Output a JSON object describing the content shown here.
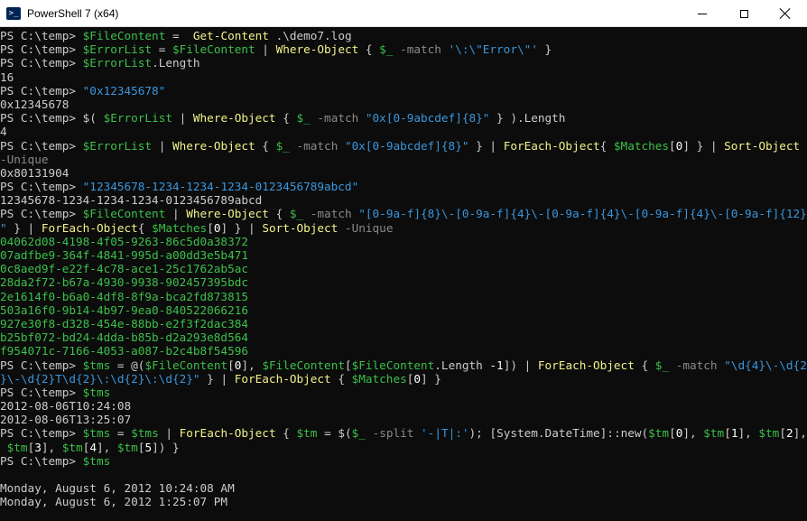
{
  "window": {
    "title": "PowerShell 7 (x64)",
    "icon": "powershell-icon",
    "icon_glyph": ">_",
    "controls": [
      "minimize-icon",
      "maximize-icon",
      "close-icon"
    ]
  },
  "colors": {
    "background": "#0c0c0c",
    "prompt": "#cccccc",
    "variable": "#3cc04a",
    "command": "#f2f28c",
    "string": "#3a96dd",
    "parameter": "#8a8a8a",
    "output": "#cccccc",
    "guid_output": "#3cc04a"
  },
  "console": {
    "lines": [
      [
        [
          "prompt",
          "PS C:\\temp> "
        ],
        [
          "var",
          "$FileContent"
        ],
        [
          "txt",
          " =  "
        ],
        [
          "cmd",
          "Get-Content"
        ],
        [
          "txt",
          " .\\demo7.log"
        ]
      ],
      [
        [
          "prompt",
          "PS C:\\temp> "
        ],
        [
          "var",
          "$ErrorList"
        ],
        [
          "txt",
          " = "
        ],
        [
          "var",
          "$FileContent"
        ],
        [
          "txt",
          " | "
        ],
        [
          "cmd",
          "Where-Object"
        ],
        [
          "txt",
          " { "
        ],
        [
          "var",
          "$_"
        ],
        [
          "txt",
          " "
        ],
        [
          "param",
          "-match"
        ],
        [
          "txt",
          " "
        ],
        [
          "str",
          "'\\:\\\"Error\\\"'"
        ],
        [
          "txt",
          " }"
        ]
      ],
      [
        [
          "prompt",
          "PS C:\\temp> "
        ],
        [
          "var",
          "$ErrorList"
        ],
        [
          "txt",
          "."
        ],
        [
          "txt",
          "Length"
        ]
      ],
      [
        [
          "out",
          "16"
        ]
      ],
      [
        [
          "prompt",
          "PS C:\\temp> "
        ],
        [
          "str",
          "\"0x12345678\""
        ]
      ],
      [
        [
          "out",
          "0x12345678"
        ]
      ],
      [
        [
          "prompt",
          "PS C:\\temp> "
        ],
        [
          "txt",
          "$( "
        ],
        [
          "var",
          "$ErrorList"
        ],
        [
          "txt",
          " | "
        ],
        [
          "cmd",
          "Where-Object"
        ],
        [
          "txt",
          " { "
        ],
        [
          "var",
          "$_"
        ],
        [
          "txt",
          " "
        ],
        [
          "param",
          "-match"
        ],
        [
          "txt",
          " "
        ],
        [
          "str",
          "\"0x[0-9abcdef]{8}\""
        ],
        [
          "txt",
          " } ).Length"
        ]
      ],
      [
        [
          "out",
          "4"
        ]
      ],
      [
        [
          "prompt",
          "PS C:\\temp> "
        ],
        [
          "var",
          "$ErrorList"
        ],
        [
          "txt",
          " | "
        ],
        [
          "cmd",
          "Where-Object"
        ],
        [
          "txt",
          " { "
        ],
        [
          "var",
          "$_"
        ],
        [
          "txt",
          " "
        ],
        [
          "param",
          "-match"
        ],
        [
          "txt",
          " "
        ],
        [
          "str",
          "\"0x[0-9abcdef]{8}\""
        ],
        [
          "txt",
          " } | "
        ],
        [
          "cmd",
          "ForEach-Object"
        ],
        [
          "txt",
          "{ "
        ],
        [
          "var",
          "$Matches"
        ],
        [
          "txt",
          "["
        ],
        [
          "num",
          "0"
        ],
        [
          "txt",
          "] } | "
        ],
        [
          "cmd",
          "Sort-Object"
        ]
      ],
      [
        [
          "param",
          "-Unique"
        ]
      ],
      [
        [
          "out",
          "0x80131904"
        ]
      ],
      [
        [
          "prompt",
          "PS C:\\temp> "
        ],
        [
          "str",
          "\"12345678-1234-1234-1234-0123456789abcd\""
        ]
      ],
      [
        [
          "out",
          "12345678-1234-1234-1234-0123456789abcd"
        ]
      ],
      [
        [
          "prompt",
          "PS C:\\temp> "
        ],
        [
          "var",
          "$FileContent"
        ],
        [
          "txt",
          " | "
        ],
        [
          "cmd",
          "Where-Object"
        ],
        [
          "txt",
          " { "
        ],
        [
          "var",
          "$_"
        ],
        [
          "txt",
          " "
        ],
        [
          "param",
          "-match"
        ],
        [
          "txt",
          " "
        ],
        [
          "str",
          "\"[0-9a-f]{8}\\-[0-9a-f]{4}\\-[0-9a-f]{4}\\-[0-9a-f]{4}\\-[0-9a-f]{12}"
        ]
      ],
      [
        [
          "str",
          "\""
        ],
        [
          "txt",
          " } | "
        ],
        [
          "cmd",
          "ForEach-Object"
        ],
        [
          "txt",
          "{ "
        ],
        [
          "var",
          "$Matches"
        ],
        [
          "txt",
          "["
        ],
        [
          "num",
          "0"
        ],
        [
          "txt",
          "] } | "
        ],
        [
          "cmd",
          "Sort-Object"
        ],
        [
          "txt",
          " "
        ],
        [
          "param",
          "-Unique"
        ]
      ],
      [
        [
          "outg",
          "04062d08-4198-4f05-9263-86c5d0a38372"
        ]
      ],
      [
        [
          "outg",
          "07adfbe9-364f-4841-995d-a00dd3e5b471"
        ]
      ],
      [
        [
          "outg",
          "0c8aed9f-e22f-4c78-ace1-25c1762ab5ac"
        ]
      ],
      [
        [
          "outg",
          "28da2f72-b67a-4930-9938-902457395bdc"
        ]
      ],
      [
        [
          "outg",
          "2e1614f0-b6a0-4df8-8f9a-bca2fd873815"
        ]
      ],
      [
        [
          "outg",
          "503a16f0-9b14-4b97-9ea0-840522066216"
        ]
      ],
      [
        [
          "outg",
          "927e30f8-d328-454e-88bb-e2f3f2dac384"
        ]
      ],
      [
        [
          "outg",
          "b25bf072-bd24-4dda-b85b-d2a293e8d564"
        ]
      ],
      [
        [
          "outg",
          "f954071c-7166-4053-a087-b2c4b8f54596"
        ]
      ],
      [
        [
          "prompt",
          "PS C:\\temp> "
        ],
        [
          "var",
          "$tms"
        ],
        [
          "txt",
          " = @("
        ],
        [
          "var",
          "$FileContent"
        ],
        [
          "txt",
          "["
        ],
        [
          "num",
          "0"
        ],
        [
          "txt",
          "], "
        ],
        [
          "var",
          "$FileContent"
        ],
        [
          "txt",
          "["
        ],
        [
          "var",
          "$FileContent"
        ],
        [
          "txt",
          ".Length "
        ],
        [
          "num",
          "-1"
        ],
        [
          "txt",
          "]) | "
        ],
        [
          "cmd",
          "ForEach-Object"
        ],
        [
          "txt",
          " { "
        ],
        [
          "var",
          "$_"
        ],
        [
          "txt",
          " "
        ],
        [
          "param",
          "-match"
        ],
        [
          "txt",
          " "
        ],
        [
          "str",
          "\"\\d{4}\\-\\d{2"
        ]
      ],
      [
        [
          "str",
          "}\\-\\d{2}T\\d{2}\\:\\d{2}\\:\\d{2}\""
        ],
        [
          "txt",
          " } | "
        ],
        [
          "cmd",
          "ForEach-Object"
        ],
        [
          "txt",
          " { "
        ],
        [
          "var",
          "$Matches"
        ],
        [
          "txt",
          "["
        ],
        [
          "num",
          "0"
        ],
        [
          "txt",
          "] }"
        ]
      ],
      [
        [
          "prompt",
          "PS C:\\temp> "
        ],
        [
          "var",
          "$tms"
        ]
      ],
      [
        [
          "out",
          "2012-08-06T10:24:08"
        ]
      ],
      [
        [
          "out",
          "2012-08-06T13:25:07"
        ]
      ],
      [
        [
          "prompt",
          "PS C:\\temp> "
        ],
        [
          "var",
          "$tms"
        ],
        [
          "txt",
          " = "
        ],
        [
          "var",
          "$tms"
        ],
        [
          "txt",
          " | "
        ],
        [
          "cmd",
          "ForEach-Object"
        ],
        [
          "txt",
          " { "
        ],
        [
          "var",
          "$tm"
        ],
        [
          "txt",
          " = $("
        ],
        [
          "var",
          "$_"
        ],
        [
          "txt",
          " "
        ],
        [
          "param",
          "-split"
        ],
        [
          "txt",
          " "
        ],
        [
          "str",
          "'-|T|:'"
        ],
        [
          "txt",
          "); [System.DateTime]::new("
        ],
        [
          "var",
          "$tm"
        ],
        [
          "txt",
          "["
        ],
        [
          "num",
          "0"
        ],
        [
          "txt",
          "], "
        ],
        [
          "var",
          "$tm"
        ],
        [
          "txt",
          "["
        ],
        [
          "num",
          "1"
        ],
        [
          "txt",
          "], "
        ],
        [
          "var",
          "$tm"
        ],
        [
          "txt",
          "["
        ],
        [
          "num",
          "2"
        ],
        [
          "txt",
          "],"
        ]
      ],
      [
        [
          "txt",
          " "
        ],
        [
          "var",
          "$tm"
        ],
        [
          "txt",
          "["
        ],
        [
          "num",
          "3"
        ],
        [
          "txt",
          "], "
        ],
        [
          "var",
          "$tm"
        ],
        [
          "txt",
          "["
        ],
        [
          "num",
          "4"
        ],
        [
          "txt",
          "], "
        ],
        [
          "var",
          "$tm"
        ],
        [
          "txt",
          "["
        ],
        [
          "num",
          "5"
        ],
        [
          "txt",
          "]) }"
        ]
      ],
      [
        [
          "prompt",
          "PS C:\\temp> "
        ],
        [
          "var",
          "$tms"
        ]
      ],
      [
        [
          "out",
          ""
        ]
      ],
      [
        [
          "out",
          "Monday, August 6, 2012 10:24:08 AM"
        ]
      ],
      [
        [
          "out",
          "Monday, August 6, 2012 1:25:07 PM"
        ]
      ]
    ]
  }
}
